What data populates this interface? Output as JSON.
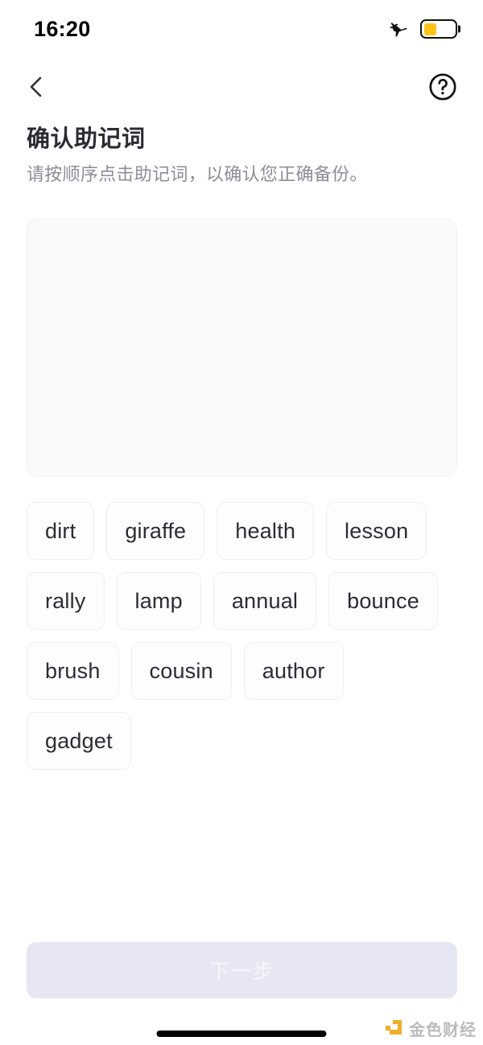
{
  "status_bar": {
    "time": "16:20",
    "airplane_icon": "airplane-mode-icon",
    "battery_icon": "battery-low-power-icon",
    "battery_level_percent": 42,
    "battery_color": "#fcc419"
  },
  "nav_bar": {
    "back_icon": "chevron-left-icon",
    "help_icon": "question-mark-circle-icon"
  },
  "page": {
    "title": "确认助记词",
    "subtitle": "请按顺序点击助记词，以确认您正确备份。"
  },
  "answer_area": {
    "selected_words": [],
    "placeholder": ""
  },
  "word_pool": {
    "words": [
      "dirt",
      "giraffe",
      "health",
      "lesson",
      "rally",
      "lamp",
      "annual",
      "bounce",
      "brush",
      "cousin",
      "author",
      "gadget"
    ]
  },
  "footer": {
    "next_label": "下一步",
    "next_enabled": false
  },
  "watermark": {
    "text": "金色财经",
    "logo_color": "#f0a818"
  }
}
